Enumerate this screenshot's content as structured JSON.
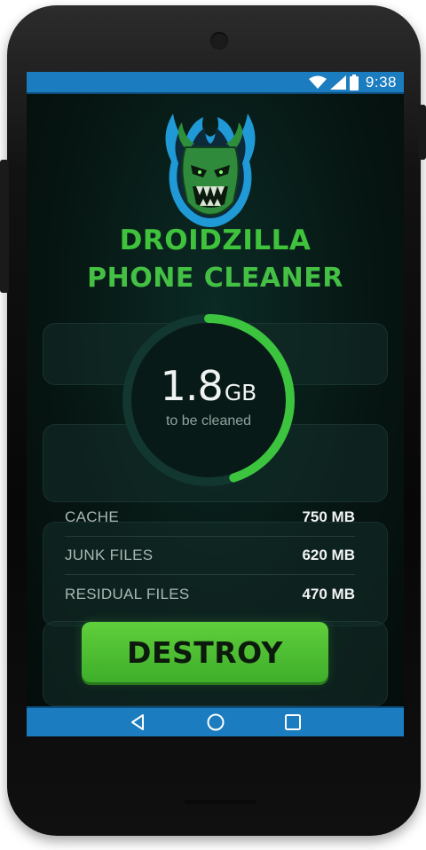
{
  "status_bar": {
    "time": "9:38",
    "icons": [
      "wifi-icon",
      "signal-icon",
      "battery-icon"
    ]
  },
  "app": {
    "logo": "devil-mascot-logo",
    "title_line1": "DROIDZILLA",
    "title_line2": "PHONE CLEANER"
  },
  "summary": {
    "value": "1.8",
    "unit": "GB",
    "caption": "to be cleaned",
    "progress_fraction": 0.45
  },
  "breakdown": [
    {
      "label": "CACHE",
      "value": "750 MB"
    },
    {
      "label": "JUNK FILES",
      "value": "620 MB"
    },
    {
      "label": "RESIDUAL FILES",
      "value": "470 MB"
    }
  ],
  "actions": {
    "destroy_label": "DESTROY"
  },
  "nav": {
    "items": [
      "back-icon",
      "home-icon",
      "recents-icon"
    ]
  },
  "colors": {
    "accent_green": "#3fc23c",
    "system_bar_blue": "#1b7cbf",
    "background": "#061411"
  }
}
